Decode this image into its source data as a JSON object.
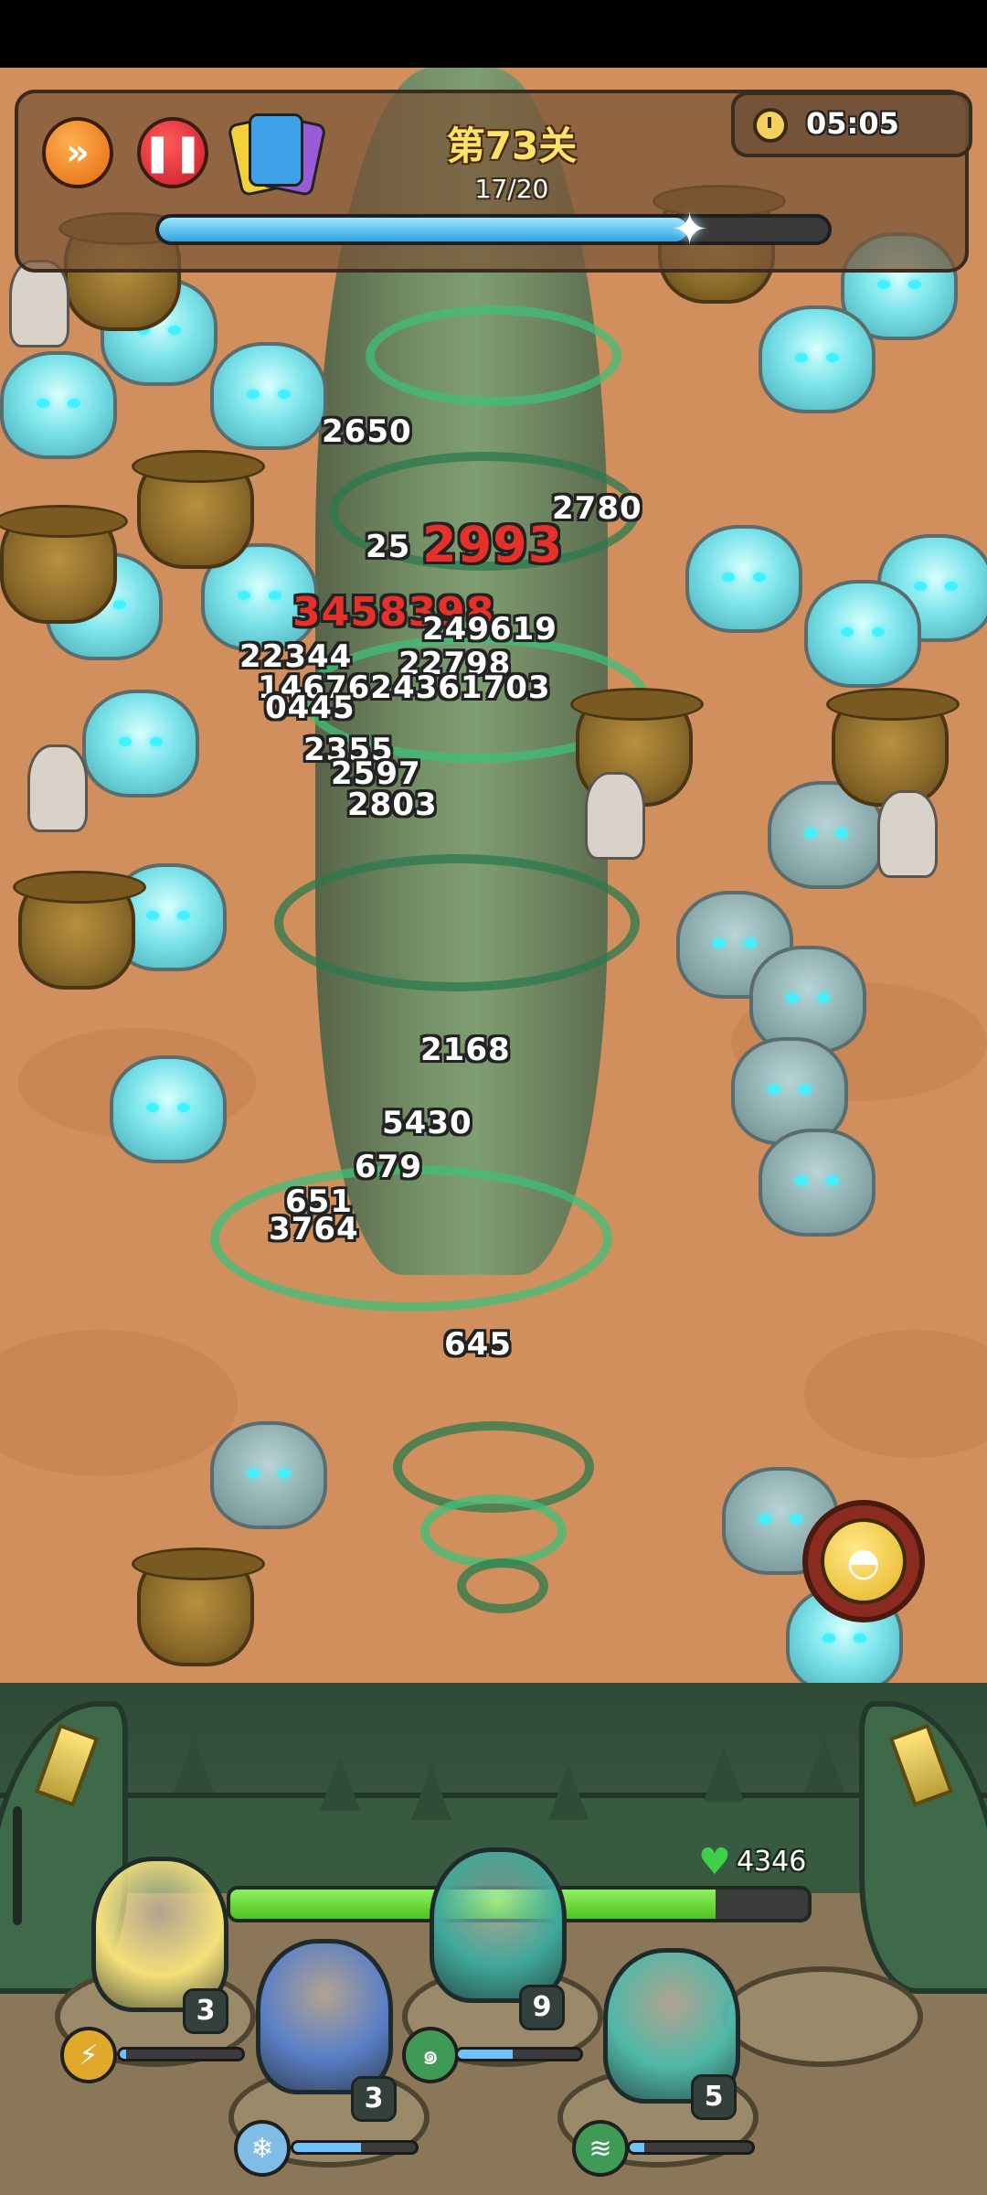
{
  "hud": {
    "level_title": "第73关",
    "wave_counter": "17/20",
    "wave_progress_fraction": 0.79,
    "timer": "05:05",
    "speed_icon": "fast-forward-icon",
    "pause_icon": "pause-icon",
    "skill_cards_icon": "skill-cards-icon"
  },
  "damage_numbers": [
    {
      "text": "2650",
      "style": "normal"
    },
    {
      "text": "2780",
      "style": "normal"
    },
    {
      "text": "2993",
      "style": "crit"
    },
    {
      "text": "25",
      "style": "normal"
    },
    {
      "text": "3458398",
      "style": "mixed"
    },
    {
      "text": "249619",
      "style": "normal"
    },
    {
      "text": "22344",
      "style": "normal"
    },
    {
      "text": "22798",
      "style": "normal"
    },
    {
      "text": "1467624361703",
      "style": "normal"
    },
    {
      "text": "0445",
      "style": "normal"
    },
    {
      "text": "2355",
      "style": "normal"
    },
    {
      "text": "2597",
      "style": "normal"
    },
    {
      "text": "2803",
      "style": "normal"
    },
    {
      "text": "2168",
      "style": "normal"
    },
    {
      "text": "5430",
      "style": "normal"
    },
    {
      "text": "679",
      "style": "normal"
    },
    {
      "text": "651",
      "style": "normal"
    },
    {
      "text": "3764",
      "style": "normal"
    },
    {
      "text": "645",
      "style": "normal"
    }
  ],
  "feed_button": {
    "icon": "pudding-icon"
  },
  "base": {
    "hp": "4346",
    "hp_fraction": 0.84,
    "heart_icon": "heart-icon"
  },
  "heroes": [
    {
      "name": "hooded-hammer-hero",
      "level": "3",
      "skill_icon": "lightning-icon",
      "energy_fraction": 0.05,
      "color": "#f4e07a"
    },
    {
      "name": "ice-knight-hero",
      "level": "3",
      "skill_icon": "ice-crystal-icon",
      "energy_fraction": 0.55,
      "color": "#5b7fc7"
    },
    {
      "name": "wind-spirit-hero",
      "level": "9",
      "skill_icon": "tornado-icon",
      "energy_fraction": 0.45,
      "color": "#3fa89a"
    },
    {
      "name": "deer-bird-hero",
      "level": "5",
      "skill_icon": "whirlwind-icon",
      "energy_fraction": 0.12,
      "color": "#4fb8a8"
    }
  ],
  "colors": {
    "sand": "#d08f5c",
    "wave_bar": "#2fa4e0",
    "hp_bar": "#4fc21e",
    "crit_text": "#e5312a"
  }
}
